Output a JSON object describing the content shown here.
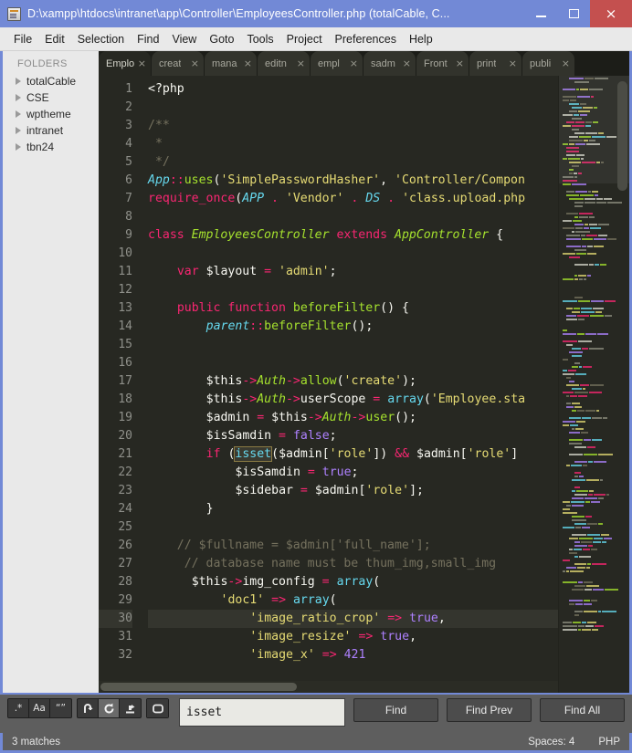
{
  "window": {
    "title": "D:\\xampp\\htdocs\\intranet\\app\\Controller\\EmployeesController.php (totalCable, C...",
    "icon": "sublime-text-icon",
    "minimize_label": "–",
    "maximize_label": "□",
    "close_label": "×",
    "titlebar_color": "#7289d6",
    "close_color": "#c4504f"
  },
  "menubar": {
    "items": [
      "File",
      "Edit",
      "Selection",
      "Find",
      "View",
      "Goto",
      "Tools",
      "Project",
      "Preferences",
      "Help"
    ]
  },
  "sidebar": {
    "header": "FOLDERS",
    "folders": [
      {
        "label": "totalCable"
      },
      {
        "label": "CSE"
      },
      {
        "label": "wptheme"
      },
      {
        "label": "intranet"
      },
      {
        "label": "tbn24"
      }
    ]
  },
  "tabs": [
    {
      "label": "Emplo",
      "close": "×",
      "active": true
    },
    {
      "label": "creat",
      "close": "×",
      "active": false
    },
    {
      "label": "mana",
      "close": "×",
      "active": false
    },
    {
      "label": "editn",
      "close": "×",
      "active": false
    },
    {
      "label": "empl",
      "close": "×",
      "active": false
    },
    {
      "label": "sadm",
      "close": "×",
      "active": false
    },
    {
      "label": "Front",
      "close": "×",
      "active": false
    },
    {
      "label": "print",
      "close": "×",
      "active": false
    },
    {
      "label": "publi",
      "close": "×",
      "active": false
    }
  ],
  "editor": {
    "first_line": 1,
    "current_line": 30,
    "line_numbers": [
      "1",
      "2",
      "3",
      "4",
      "5",
      "6",
      "7",
      "8",
      "9",
      "10",
      "11",
      "12",
      "13",
      "14",
      "15",
      "16",
      "17",
      "18",
      "19",
      "20",
      "21",
      "22",
      "23",
      "24",
      "25",
      "26",
      "27",
      "28",
      "29",
      "30",
      "31",
      "32"
    ],
    "lines": [
      "<?php",
      "",
      "/**",
      " *",
      " */",
      "App::uses('SimplePasswordHasher', 'Controller/Compon",
      "require_once(APP . 'Vendor' . DS . 'class.upload.php",
      "",
      "class EmployeesController extends AppController {",
      "",
      "    var $layout = 'admin';",
      "",
      "    public function beforeFilter() {",
      "        parent::beforeFilter();",
      "",
      "",
      "        $this->Auth->allow('create');",
      "        $this->Auth->userScope = array('Employee.sta",
      "        $admin = $this->Auth->user();",
      "        $isSamdin = false;",
      "        if (isset($admin['role']) && $admin['role']",
      "            $isSamdin = true;",
      "            $sidebar = $admin['role'];",
      "        }",
      "",
      "    // $fullname = $admin['full_name'];",
      "     // database name must be thum_img,small_img",
      "      $this->img_config = array(",
      "          'doc1' => array(",
      "              'image_ratio_crop' => true,",
      "              'image_resize' => true,",
      "              'image_x' => 421"
    ],
    "search_match_token": "isset"
  },
  "find": {
    "query": "isset",
    "placeholder": "Find",
    "toggles": [
      {
        "name": "regex-toggle",
        "label": ".*",
        "on": false
      },
      {
        "name": "case-sensitive-toggle",
        "label": "Aa",
        "on": false
      },
      {
        "name": "whole-word-toggle",
        "label": "“”",
        "on": false
      },
      {
        "name": "wrap-toggle",
        "label": "wrap-icon",
        "on": false
      },
      {
        "name": "in-selection-toggle",
        "label": "in-selection-icon",
        "on": true
      },
      {
        "name": "highlight-toggle",
        "label": "highlight-icon",
        "on": false
      },
      {
        "name": "preserve-case-toggle",
        "label": "preserve-case-icon",
        "on": false
      }
    ],
    "buttons": [
      {
        "name": "find-button",
        "label": "Find"
      },
      {
        "name": "find-prev-button",
        "label": "Find Prev"
      },
      {
        "name": "find-all-button",
        "label": "Find All"
      }
    ]
  },
  "status": {
    "matches": "3 matches",
    "indent": "Spaces: 4",
    "syntax": "PHP"
  }
}
